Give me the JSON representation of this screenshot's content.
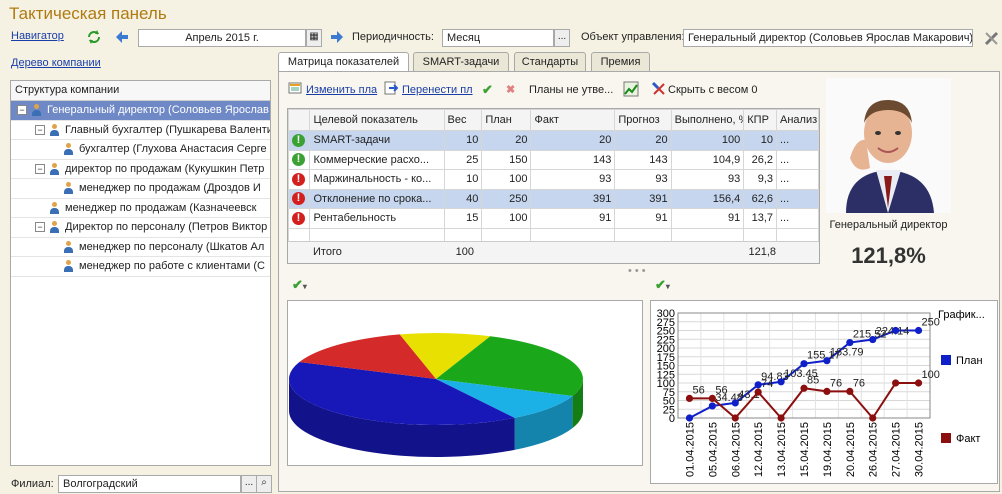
{
  "window": {
    "title": "Тактическая панель"
  },
  "toolbar": {
    "navigator": "Навигатор",
    "period_value": "Апрель 2015 г.",
    "periodicity_label": "Периодичность:",
    "periodicity_value": "Месяц",
    "object_label": "Объект управления:",
    "object_value": "Генеральный директор (Соловьев Ярослав Макарович)"
  },
  "left": {
    "tree_link": "Дерево компании",
    "header": "Структура компании",
    "nodes": [
      {
        "label": "Генеральный директор (Соловьев Ярослав",
        "toggle": "⊟"
      },
      {
        "label": "Главный бухгалтер (Пушкарева Валенти",
        "toggle": "⊟"
      },
      {
        "label": "бухгалтер (Глухова Анастасия Серге",
        "toggle": ""
      },
      {
        "label": "директор по продажам (Кукушкин Петр",
        "toggle": "⊟"
      },
      {
        "label": "менеджер по продажам (Дроздов И",
        "toggle": ""
      },
      {
        "label": "менеджер по продажам (Казначеевск",
        "toggle": ""
      },
      {
        "label": "Директор по персоналу (Петров Виктор",
        "toggle": "⊟"
      },
      {
        "label": "менеджер по персоналу (Шкатов Ал",
        "toggle": ""
      },
      {
        "label": "менеджер по работе с клиентами (С",
        "toggle": ""
      }
    ],
    "branch_label": "Филиал:",
    "branch_value": "Волгоградский"
  },
  "tabs": [
    "Матрица показателей",
    "SMART-задачи",
    "Стандарты",
    "Премия"
  ],
  "grid_toolbar": {
    "change_plan": "Изменить пла",
    "move_plan": "Перенести пл",
    "plans_status": "Планы не утве...",
    "hide_weight": "Скрыть с весом 0"
  },
  "grid": {
    "columns": [
      "",
      "Целевой показатель",
      "Вес",
      "План",
      "Факт",
      "Прогноз",
      "Выполнено, %",
      "КПР",
      "Анализ"
    ],
    "rows": [
      {
        "status": "ok",
        "name": "SMART-задачи",
        "weight": "10",
        "plan": "20",
        "fact": "20",
        "forecast": "20",
        "done": "100",
        "kpr": "10",
        "analysis": "..."
      },
      {
        "status": "ok",
        "name": "Коммерческие расхо...",
        "weight": "25",
        "plan": "150",
        "fact": "143",
        "forecast": "143",
        "done": "104,9",
        "kpr": "26,2",
        "analysis": "..."
      },
      {
        "status": "bad",
        "name": "Маржинальность - ко...",
        "weight": "10",
        "plan": "100",
        "fact": "93",
        "forecast": "93",
        "done": "93",
        "kpr": "9,3",
        "analysis": "..."
      },
      {
        "status": "bad",
        "name": "Отклонение по срока...",
        "weight": "40",
        "plan": "250",
        "fact": "391",
        "forecast": "391",
        "done": "156,4",
        "kpr": "62,6",
        "analysis": "..."
      },
      {
        "status": "bad",
        "name": "Рентабельность",
        "weight": "15",
        "plan": "100",
        "fact": "91",
        "forecast": "91",
        "done": "91",
        "kpr": "13,7",
        "analysis": "..."
      }
    ],
    "total_label": "Итого",
    "total_weight": "100",
    "total_kpr": "121,8"
  },
  "profile": {
    "position": "Генеральный директор",
    "score": "121,8%"
  },
  "chart_data": [
    {
      "type": "pie",
      "labels": [
        "",
        "",
        "",
        "",
        ""
      ],
      "values": [
        10,
        25,
        10,
        40,
        15
      ],
      "colors": [
        "#e8e000",
        "#1aa81a",
        "#1bb0e6",
        "#1818b8",
        "#d42a2a"
      ]
    },
    {
      "type": "line",
      "title": "График...",
      "x": [
        "01.04.2015",
        "05.04.2015",
        "06.04.2015",
        "12.04.2015",
        "13.04.2015",
        "15.04.2015",
        "19.04.2015",
        "20.04.2015",
        "26.04.2015",
        "27.04.2015",
        "30.04.2015"
      ],
      "ylim": [
        0,
        300
      ],
      "yticks": [
        0,
        25,
        50,
        75,
        100,
        125,
        150,
        175,
        200,
        225,
        250,
        275,
        300
      ],
      "series": [
        {
          "name": "План",
          "color": "#1020c8",
          "values": [
            0,
            34.48,
            43.1,
            94.83,
            103.45,
            155.17,
            163.79,
            215.52,
            224.14,
            250,
            250
          ],
          "labels": [
            "",
            "34.48",
            "43.1",
            "94.83",
            "103.45",
            "155.17",
            "163.79",
            "215.52",
            "224.14",
            "",
            "250"
          ]
        },
        {
          "name": "Факт",
          "color": "#8b0f0f",
          "values": [
            56,
            56,
            0,
            74,
            0,
            85,
            76,
            76,
            0,
            100,
            100
          ],
          "labels": [
            "56",
            "56",
            "",
            "74",
            "",
            "85",
            "76",
            "76",
            "",
            "",
            "100"
          ]
        }
      ]
    }
  ]
}
